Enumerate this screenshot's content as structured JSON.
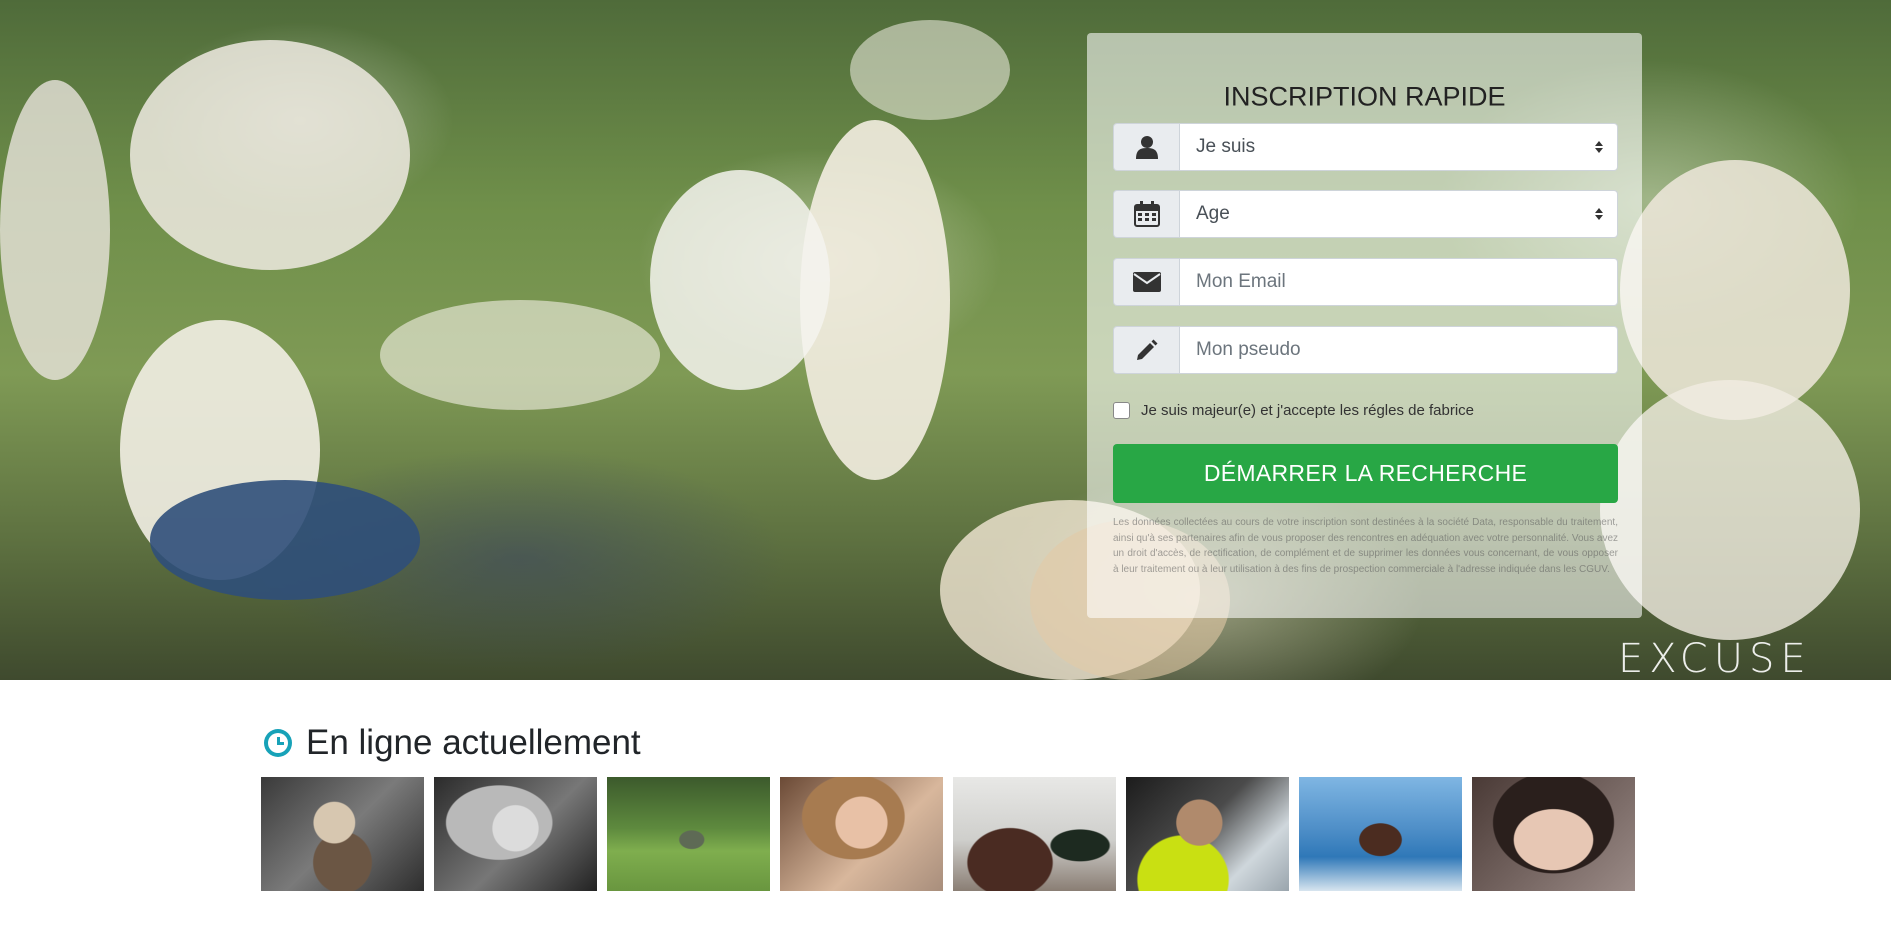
{
  "hero": {
    "watermark": "EXCUSE"
  },
  "form": {
    "title": "INSCRIPTION RAPIDE",
    "fields": {
      "sex": {
        "icon": "user-icon",
        "value": "Je suis"
      },
      "age": {
        "icon": "calendar-icon",
        "value": "Age"
      },
      "email": {
        "icon": "envelope-icon",
        "placeholder": "Mon Email"
      },
      "pseudo": {
        "icon": "pencil-icon",
        "placeholder": "Mon pseudo"
      }
    },
    "consent_label": "Je suis majeur(e) et j'accepte les régles de fabrice",
    "submit_label": "DÉMARRER LA RECHERCHE",
    "submit_color": "#28a745",
    "disclaimer": "Les données collectées au cours de votre inscription sont destinées à la société Data, responsable du traitement, ainsi qu'à ses partenaires afin de vous proposer des rencontres en adéquation avec votre personnalité. Vous avez un droit d'accès, de rectification, de complément et de supprimer les données vous concernant, de vous opposer à leur traitement ou à leur utilisation à des fins de prospection commerciale à l'adresse indiquée dans les CGUV."
  },
  "online": {
    "icon": "clock-icon",
    "icon_color": "#17a2b8",
    "title": "En ligne actuellement",
    "profiles": [
      {
        "name": "profile-photo-1"
      },
      {
        "name": "profile-photo-2"
      },
      {
        "name": "profile-photo-3"
      },
      {
        "name": "profile-photo-4"
      },
      {
        "name": "profile-photo-5"
      },
      {
        "name": "profile-photo-6"
      },
      {
        "name": "profile-photo-7"
      },
      {
        "name": "profile-photo-8"
      }
    ]
  }
}
